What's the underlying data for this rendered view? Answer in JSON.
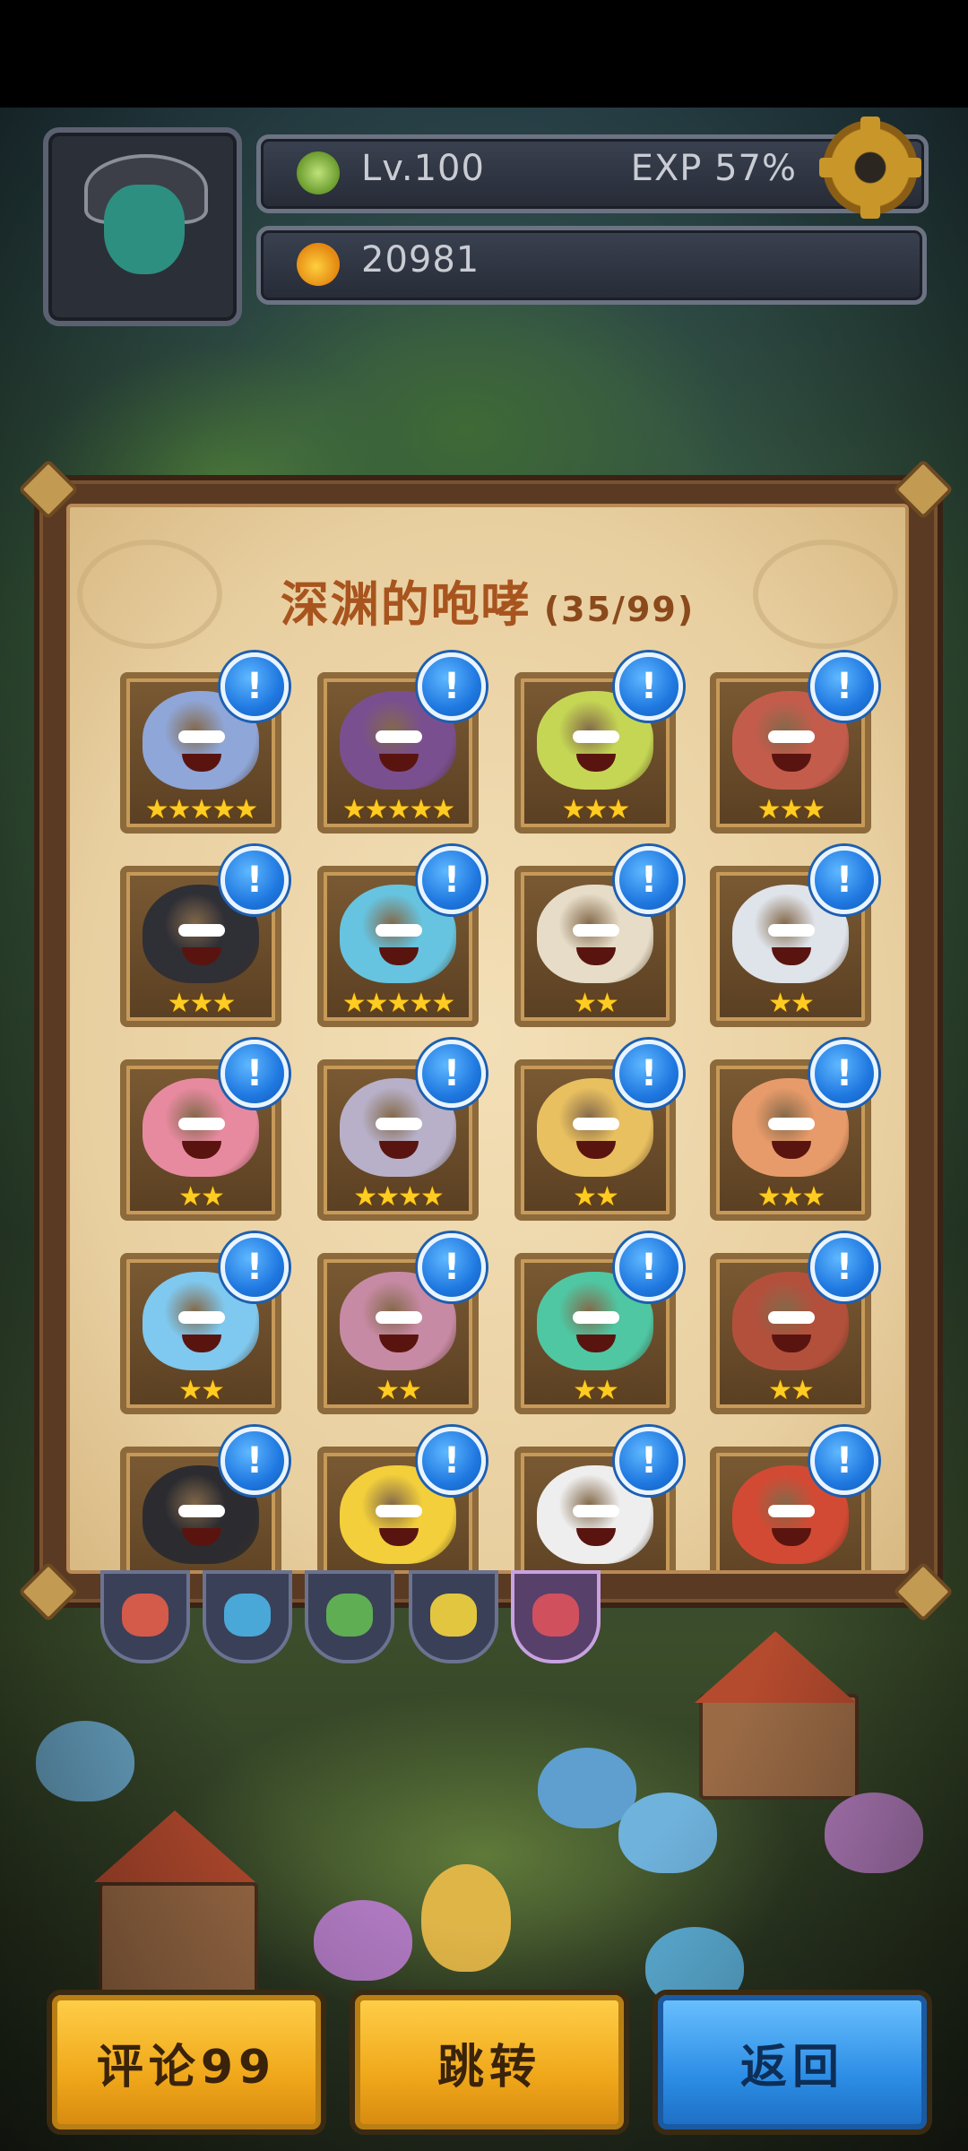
{
  "hud": {
    "level": "Lv.100",
    "exp": "EXP 57%",
    "gold": "20981"
  },
  "panel": {
    "title": "深渊的咆哮",
    "count": "(35/99)",
    "badge_symbol": "!",
    "cards": [
      {
        "name": "ice-knight-monster",
        "stars": "★★★★★",
        "color": "#8fa6d8"
      },
      {
        "name": "bat-monster",
        "stars": "★★★★★",
        "color": "#7a4f8f"
      },
      {
        "name": "cannon-monster",
        "stars": "★★★",
        "color": "#c5d654"
      },
      {
        "name": "robot-monster",
        "stars": "★★★",
        "color": "#c45c4c"
      },
      {
        "name": "black-knight-monster",
        "stars": "★★★",
        "color": "#2f2f36"
      },
      {
        "name": "samurai-monster",
        "stars": "★★★★★",
        "color": "#66c4e0"
      },
      {
        "name": "lion-king-monster",
        "stars": "★★",
        "color": "#e6dcc8"
      },
      {
        "name": "skeleton-king-monster",
        "stars": "★★",
        "color": "#dfe3ea"
      },
      {
        "name": "queen-monster",
        "stars": "★★",
        "color": "#e78aa0"
      },
      {
        "name": "bishop-monster",
        "stars": "★★★★",
        "color": "#b7b0c8"
      },
      {
        "name": "toy-soldier-monster",
        "stars": "★★",
        "color": "#e9c060"
      },
      {
        "name": "fox-monster",
        "stars": "★★★",
        "color": "#e89b6a"
      },
      {
        "name": "ice-dragon-monster",
        "stars": "★★",
        "color": "#7fc8ef"
      },
      {
        "name": "geisha-monster",
        "stars": "★★",
        "color": "#c78aa4"
      },
      {
        "name": "magician-monster",
        "stars": "★★",
        "color": "#4fc7a3"
      },
      {
        "name": "warlord-monster",
        "stars": "★★",
        "color": "#b3503c"
      },
      {
        "name": "top-hat-monster",
        "stars": "",
        "color": "#2c2c30"
      },
      {
        "name": "box-monster",
        "stars": "",
        "color": "#f2cf3b"
      },
      {
        "name": "chicken-monster",
        "stars": "",
        "color": "#eeeeee"
      },
      {
        "name": "red-hair-monster",
        "stars": "",
        "color": "#d34a34"
      }
    ]
  },
  "tabs": [
    {
      "name": "tab-red",
      "color": "#d45a4a"
    },
    {
      "name": "tab-blue",
      "color": "#4aa8d8"
    },
    {
      "name": "tab-green",
      "color": "#5fae54"
    },
    {
      "name": "tab-yellow",
      "color": "#e3c640"
    },
    {
      "name": "tab-purple",
      "color": "#d0505e"
    }
  ],
  "buttons": {
    "comment": "评论99",
    "jump": "跳转",
    "back": "返回"
  }
}
